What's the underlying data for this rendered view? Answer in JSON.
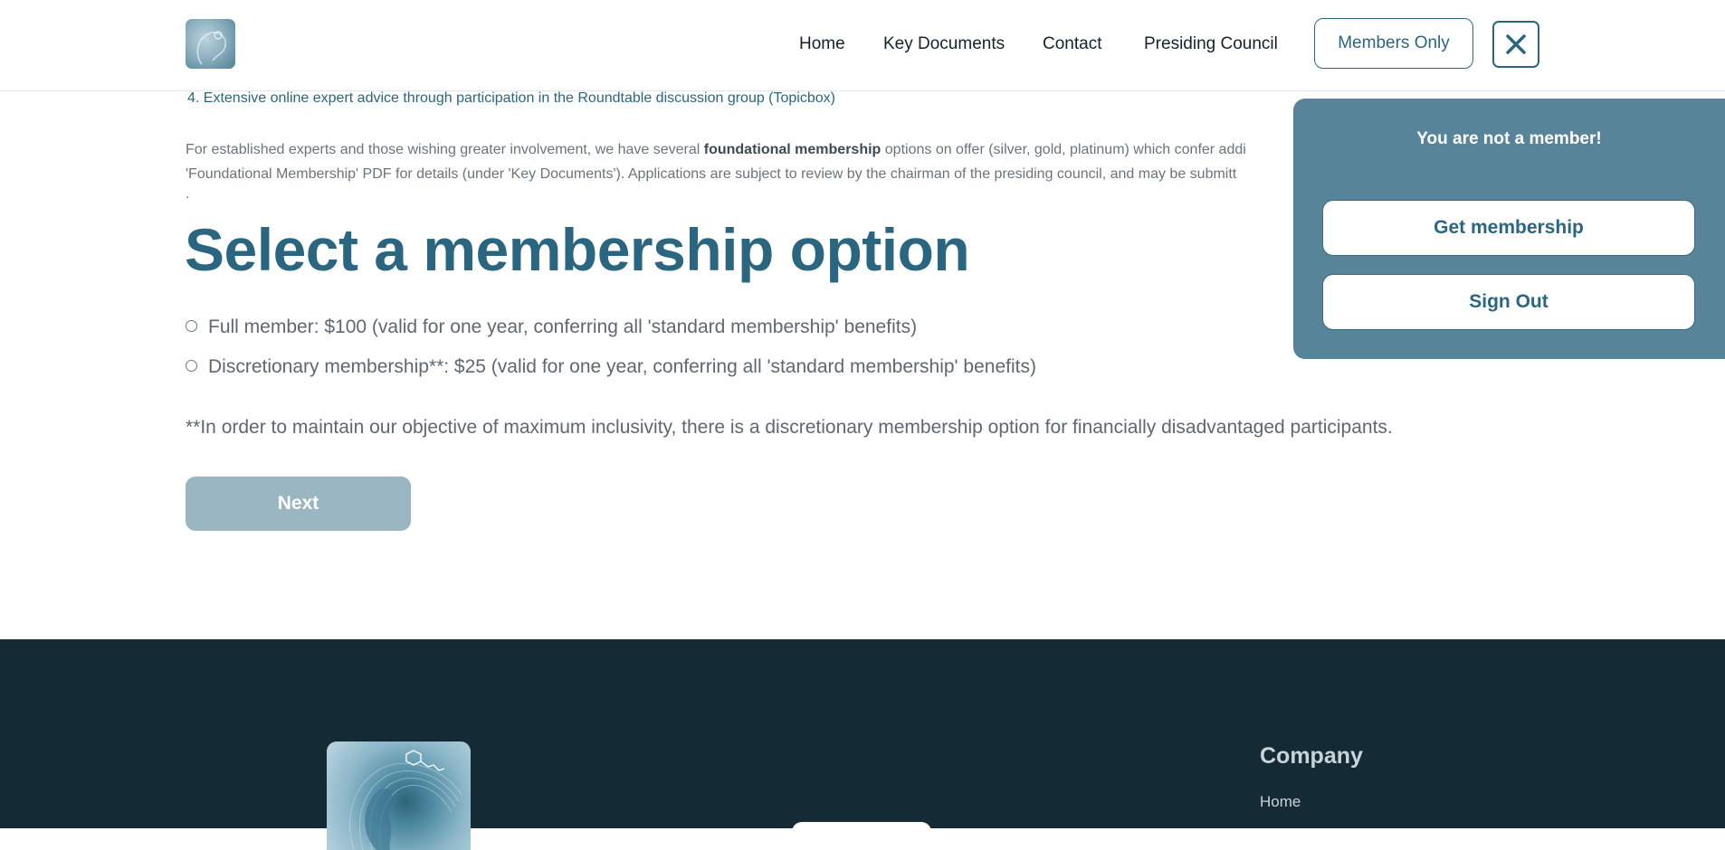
{
  "header": {
    "logo_alt": "logo",
    "nav": [
      "Home",
      "Key Documents",
      "Contact",
      "Presiding Council"
    ],
    "members_button": "Members Only"
  },
  "content": {
    "list_item": "4. Extensive online expert advice through participation in the Roundtable discussion group (Topicbox)",
    "para_line1_pre": "For established experts and those wishing greater involvement, we have several ",
    "para_line1_bold": "foundational membership",
    "para_line1_post": " options on offer (silver, gold, platinum) which confer addi",
    "para_line2": "'Foundational Membership' PDF for details (under 'Key Documents'). Applications are subject to review by the chairman of the presiding council, and may be submitt",
    "para_line3": ".",
    "heading": "Select a membership option",
    "options": [
      "Full member: $100 (valid for one year, conferring all 'standard membership' benefits)",
      "Discretionary membership**: $25 (valid for one year, conferring all 'standard membership' benefits)"
    ],
    "note": "**In order to maintain our objective of maximum inclusivity, there is a discretionary membership option for financially disadvantaged participants.",
    "next_button": "Next"
  },
  "popup": {
    "title": "You are not a member!",
    "get_membership": "Get membership",
    "sign_out": "Sign Out"
  },
  "footer": {
    "company_heading": "Company",
    "links": [
      "Home"
    ]
  },
  "colors": {
    "accent": "#2b6680",
    "popup_bg": "#578498",
    "footer_bg": "#142b35",
    "next_bg": "#9ab6c1"
  }
}
